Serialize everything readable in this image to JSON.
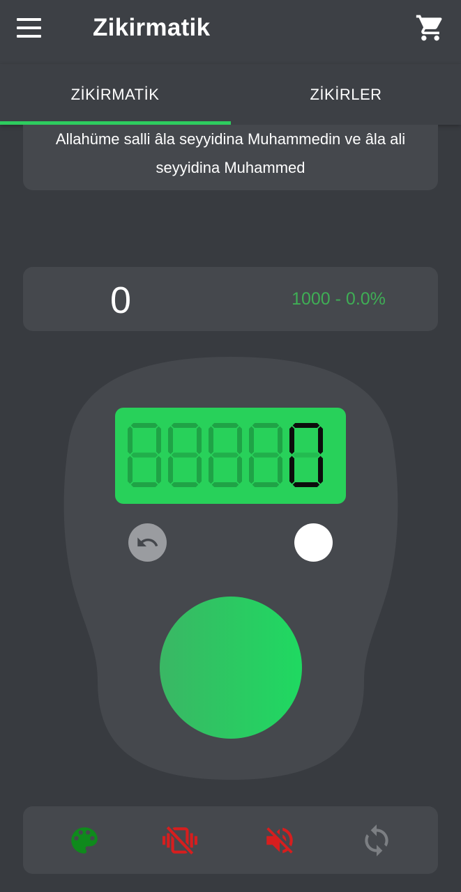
{
  "appbar": {
    "title": "Zikirmatik",
    "icons": {
      "menu": "hamburger-menu-icon",
      "cart": "shopping-cart-icon"
    }
  },
  "tabs": [
    {
      "label": "ZİKİRMATİK",
      "active": true
    },
    {
      "label": "ZİKİRLER",
      "active": false
    }
  ],
  "zikr": {
    "text": "Allahüme salli âla seyyidina Muhammedin ve âla ali seyyidina Muhammed"
  },
  "counter": {
    "count": "0",
    "goal_progress": "1000 - 0.0%"
  },
  "device": {
    "display_digits": [
      "0",
      "0",
      "0",
      "0",
      "0"
    ],
    "display_active_digit": 5,
    "led_color": "#ffffff",
    "button_color": "#2ecc5f",
    "icons": {
      "undo": "undo-icon"
    }
  },
  "toolbar": {
    "icons": [
      "palette-icon",
      "vibration-off-icon",
      "volume-off-icon",
      "sync-icon"
    ],
    "colors": {
      "palette": "#0f8a1c",
      "vibration_off": "#d61e1e",
      "volume_off": "#d61e1e",
      "sync": "#7c7f83"
    }
  },
  "theme": {
    "background": "#383b40",
    "appbar": "#3d4045",
    "card": "#45484d",
    "accent": "#2ecc5f",
    "accent_text": "#3fae55"
  }
}
